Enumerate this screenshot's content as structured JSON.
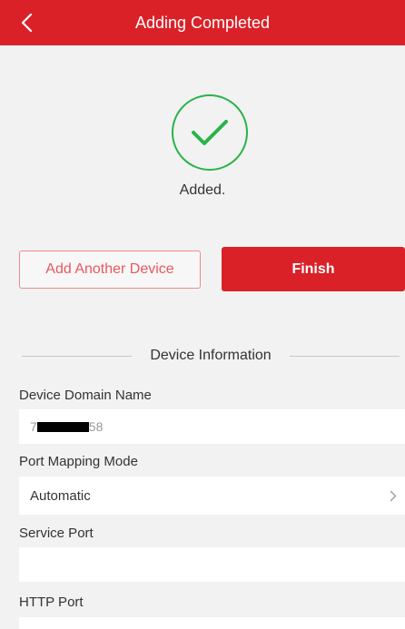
{
  "header": {
    "title": "Adding Completed",
    "back_icon": "chevron-left-icon",
    "bg_color": "#da2128"
  },
  "status": {
    "icon": "checkmark-circle-icon",
    "icon_color": "#29b34a",
    "message": "Added."
  },
  "actions": {
    "add_another_label": "Add Another Device",
    "finish_label": "Finish"
  },
  "section": {
    "title": "Device Information"
  },
  "fields": {
    "domain_name": {
      "label": "Device Domain Name",
      "value_prefix": "7",
      "value_suffix": "58"
    },
    "port_mapping": {
      "label": "Port Mapping Mode",
      "value": "Automatic",
      "chevron_icon": "chevron-right-icon"
    },
    "service_port": {
      "label": "Service Port",
      "value": ""
    },
    "http_port": {
      "label": "HTTP Port",
      "value": ""
    }
  }
}
